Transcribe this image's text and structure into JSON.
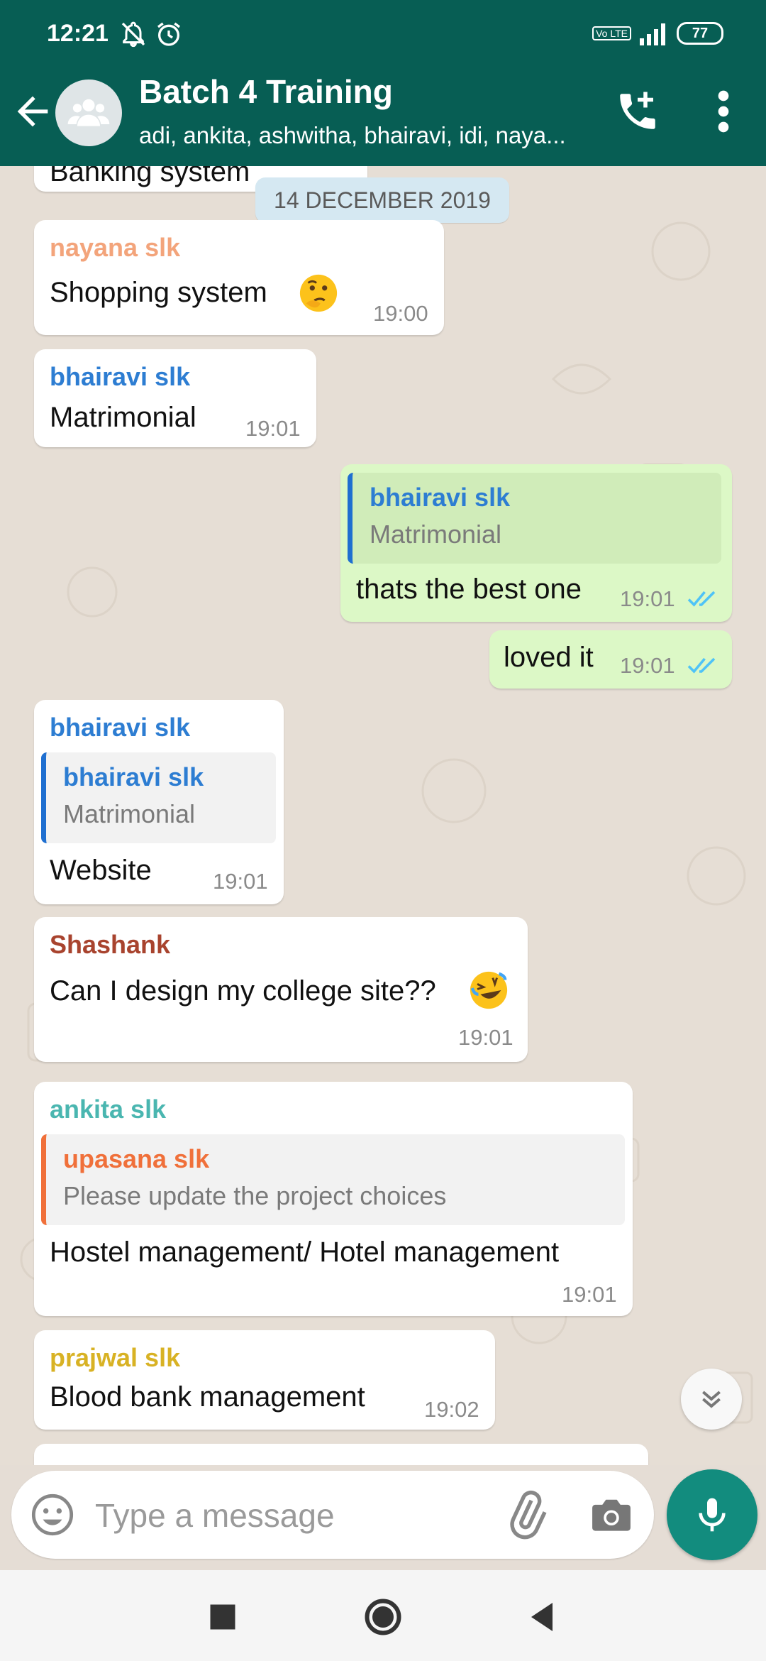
{
  "status_bar": {
    "time": "12:21",
    "battery": "77",
    "volte": "Vo LTE"
  },
  "header": {
    "title": "Batch 4 Training",
    "subtitle": "adi, ankita, ashwitha, bhairavi, idi, naya..."
  },
  "chat": {
    "date_chip": "14 DECEMBER 2019",
    "partial_top_text": "Banking system",
    "messages": [
      {
        "sender": "nayana slk",
        "sender_color": "#f3a47b",
        "text": "Shopping system",
        "emoji": "thinking-face",
        "time": "19:00"
      },
      {
        "sender": "bhairavi slk",
        "sender_color": "#2d7dd2",
        "text": "Matrimonial",
        "time": "19:01"
      },
      {
        "outgoing": true,
        "quote": {
          "sender": "bhairavi slk",
          "text": "Matrimonial"
        },
        "text": "thats the best one",
        "time": "19:01"
      },
      {
        "outgoing": true,
        "text": "loved it",
        "time": "19:01"
      },
      {
        "sender": "bhairavi slk",
        "sender_color": "#2d7dd2",
        "quote": {
          "sender": "bhairavi slk",
          "text": "Matrimonial"
        },
        "text": "Website",
        "time": "19:01"
      },
      {
        "sender": "Shashank",
        "sender_color": "#a8432e",
        "text": "Can I design my college site??",
        "emoji": "rolling-laughing-face",
        "time": "19:01"
      },
      {
        "sender": "ankita slk",
        "sender_color": "#4ab6b0",
        "quote": {
          "sender": "upasana slk",
          "sender_color": "#f0703a",
          "text": "Please update the project choices"
        },
        "text": "Hostel management/ Hotel management",
        "time": "19:01"
      },
      {
        "sender": "prajwal slk",
        "sender_color": "#d8b224",
        "text": "Blood bank management",
        "time": "19:02"
      }
    ]
  },
  "composer": {
    "placeholder": "Type a message"
  },
  "colors": {
    "header": "#075e54",
    "accent": "#128c7e",
    "outgoing_bubble": "#dcf8c6",
    "read_ticks": "#4fc3f7"
  }
}
